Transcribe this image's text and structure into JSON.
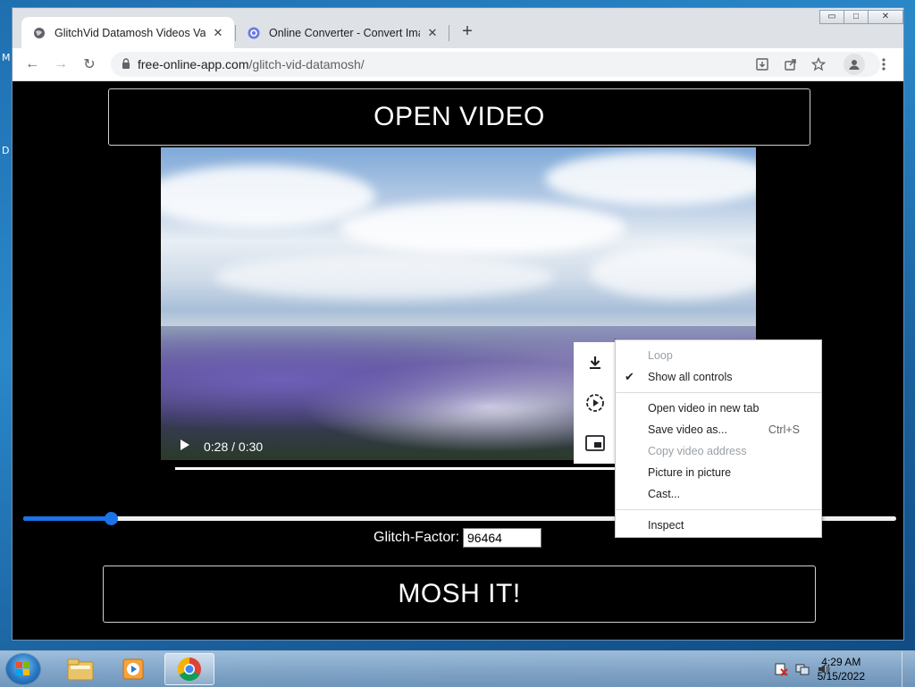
{
  "desktop": {
    "edge_letters": [
      "M",
      "D"
    ]
  },
  "browser": {
    "tabs": [
      {
        "title": "GlitchVid Datamosh Videos Vapo",
        "active": true,
        "close": "✕"
      },
      {
        "title": "Online Converter - Convert Imag",
        "active": false,
        "close": "✕"
      }
    ],
    "new_tab": "+",
    "window_controls": {
      "minimize": "▭",
      "maximize": "□",
      "close": "✕"
    },
    "nav": {
      "back": "←",
      "forward": "→",
      "reload": "↻"
    },
    "address": {
      "host": "free-online-app.com",
      "path": "/glitch-vid-datamosh/"
    }
  },
  "page": {
    "open_video_label": "OPEN VIDEO",
    "video": {
      "time": "0:28 / 0:30",
      "progress": 0.93
    },
    "slider": {
      "value_fraction": 0.1
    },
    "glitch_label": "Glitch-Factor:",
    "glitch_value": "96464",
    "mosh_label": "MOSH IT!"
  },
  "context_menu": {
    "items": [
      {
        "label": "Loop",
        "disabled": true
      },
      {
        "label": "Show all controls",
        "checked": true
      },
      {
        "sep": true
      },
      {
        "label": "Open video in new tab"
      },
      {
        "label": "Save video as...",
        "shortcut": "Ctrl+S"
      },
      {
        "label": "Copy video address",
        "disabled": true
      },
      {
        "label": "Picture in picture"
      },
      {
        "label": "Cast..."
      },
      {
        "sep": true
      },
      {
        "label": "Inspect"
      }
    ]
  },
  "taskbar": {
    "clock": {
      "time": "4:29 AM",
      "date": "5/15/2022"
    }
  },
  "colors": {
    "accent": "#1a73e8",
    "page_bg": "#000000"
  }
}
